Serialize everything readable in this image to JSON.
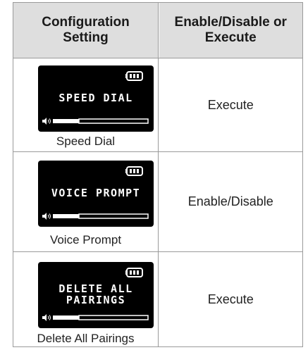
{
  "header": {
    "col1_line1": "Configuration",
    "col1_line2": "Setting",
    "col2_line1": "Enable/Disable or",
    "col2_line2": "Execute"
  },
  "rows": [
    {
      "screen_line1": "SPEED DIAL",
      "screen_line2": "",
      "caption": "Speed Dial",
      "action": "Execute"
    },
    {
      "screen_line1": "VOICE PROMPT",
      "screen_line2": "",
      "caption": "Voice Prompt",
      "action": "Enable/Disable"
    },
    {
      "screen_line1": "DELETE ALL",
      "screen_line2": "PAIRINGS",
      "caption": "Delete All Pairings",
      "action": "Execute"
    }
  ],
  "icons": {
    "battery": "battery-icon",
    "volume": "speaker-icon"
  },
  "colors": {
    "header_bg": "#dedede",
    "border": "#9a9a9a",
    "screen_bg": "#000000",
    "screen_fg": "#ffffff"
  }
}
